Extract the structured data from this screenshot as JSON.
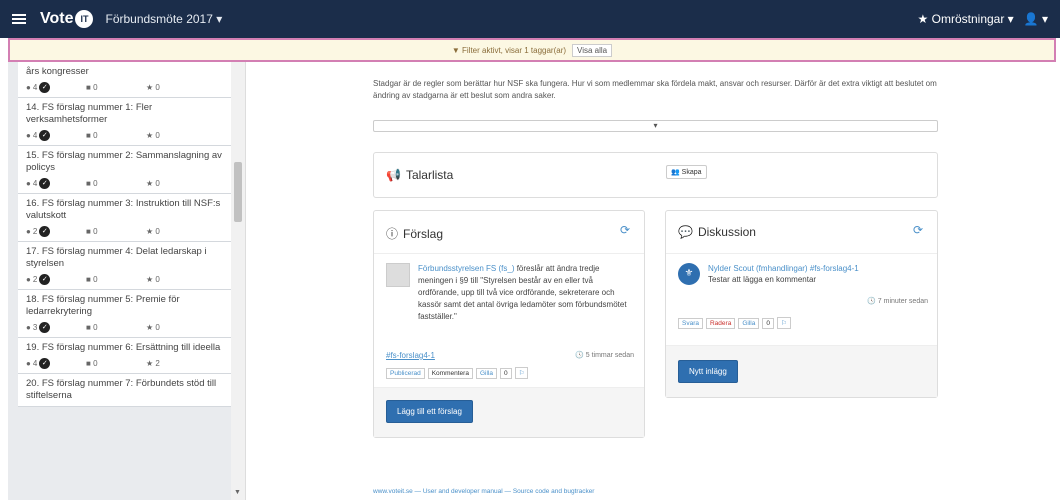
{
  "navbar": {
    "brand": "Vote",
    "brand_badge": "IT",
    "meeting": "Förbundsmöte 2017 ▾",
    "polls": "★ Omröstningar ▾",
    "user": "👤 ▾"
  },
  "filter": {
    "text": "▼ Filter aktivt, visar 1 taggar(ar)",
    "button": "Visa alla"
  },
  "sidebar": {
    "items": [
      {
        "title": "års kongresser",
        "votes": "4",
        "comments": "0",
        "stars": "0"
      },
      {
        "title": "14. FS förslag nummer 1: Fler verksamhetsformer",
        "votes": "4",
        "comments": "0",
        "stars": "0"
      },
      {
        "title": "15. FS förslag nummer 2: Sammanslagning av policys",
        "votes": "4",
        "comments": "0",
        "stars": "0"
      },
      {
        "title": "16. FS förslag nummer 3: Instruktion till NSF:s valutskott",
        "votes": "2",
        "comments": "0",
        "stars": "0"
      },
      {
        "title": "17. FS förslag nummer 4: Delat ledarskap i styrelsen",
        "votes": "2",
        "comments": "0",
        "stars": "0"
      },
      {
        "title": "18. FS förslag nummer 5: Premie för ledarrekrytering",
        "votes": "3",
        "comments": "0",
        "stars": "0"
      },
      {
        "title": "19. FS förslag nummer 6: Ersättning till ideella",
        "votes": "4",
        "comments": "0",
        "stars": "2"
      },
      {
        "title": "20. FS förslag nummer 7: Förbundets stöd till stiftelserna",
        "votes": "",
        "comments": "",
        "stars": ""
      }
    ]
  },
  "main": {
    "intro": "Stadgar är de regler som berättar hur NSF ska fungera. Hur vi som medlemmar ska fördela makt, ansvar och resurser. Därför är det extra viktigt att beslutet om ändring av stadgarna är ett beslut som andra saker.",
    "collapse_icon": "▾",
    "talarlista": {
      "title": "Talarlista",
      "button": "Skapa"
    },
    "forslag": {
      "title": "Förslag",
      "author": "Förbundsstyrelsen FS (fs_)",
      "text": " föreslår att ändra tredje meningen i §9 till \"Styrelsen består av en eller två ordförande, upp till två vice ordförande, sekreterare och kassör samt det antal övriga ledamöter som förbundsmötet fastställer.\"",
      "tag": "#fs-forslag4-1",
      "time": "5 timmar sedan",
      "actions": [
        "Publicerad",
        "Kommentera",
        "Gilla",
        "0",
        "⚐"
      ],
      "add_button": "Lägg till ett förslag"
    },
    "diskussion": {
      "title": "Diskussion",
      "author": "Nylder Scout (fmhandlingar) #fs-forslag4-1",
      "text": "Testar att lägga en kommentar",
      "time": "7 minuter sedan",
      "actions": [
        "Svara",
        "Radera",
        "Gilla",
        "0",
        "⚐"
      ],
      "new_button": "Nytt inlägg"
    }
  },
  "footer": "www.voteit.se — User and developer manual — Source code and bugtracker"
}
